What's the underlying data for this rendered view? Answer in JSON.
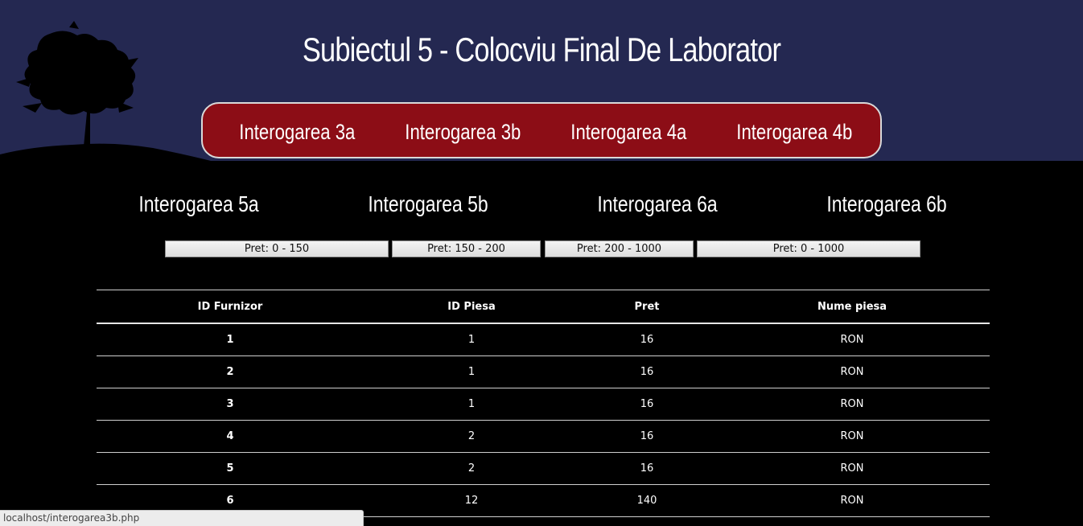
{
  "site": {
    "title": "Subiectul 5 - Colocviu Final De Laborator"
  },
  "nav": {
    "items": [
      {
        "label": "Interogarea 3a"
      },
      {
        "label": "Interogarea 3b"
      },
      {
        "label": "Interogarea 4a"
      },
      {
        "label": "Interogarea 4b"
      }
    ]
  },
  "subnav": {
    "items": [
      {
        "label": "Interogarea 5a"
      },
      {
        "label": "Interogarea 5b"
      },
      {
        "label": "Interogarea 6a"
      },
      {
        "label": "Interogarea 6b"
      }
    ]
  },
  "filters": {
    "buttons": [
      {
        "label": "Pret: 0 - 150"
      },
      {
        "label": "Pret: 150 - 200"
      },
      {
        "label": "Pret: 200 - 1000"
      },
      {
        "label": "Pret: 0 - 1000"
      }
    ]
  },
  "table": {
    "headers": [
      "ID Furnizor",
      "ID Piesa",
      "Pret",
      "Nume piesa"
    ],
    "rows": [
      [
        "1",
        "1",
        "16",
        "RON"
      ],
      [
        "2",
        "1",
        "16",
        "RON"
      ],
      [
        "3",
        "1",
        "16",
        "RON"
      ],
      [
        "4",
        "2",
        "16",
        "RON"
      ],
      [
        "5",
        "2",
        "16",
        "RON"
      ],
      [
        "6",
        "12",
        "140",
        "RON"
      ]
    ]
  },
  "status": {
    "url": "localhost/interogarea3b.php"
  },
  "colors": {
    "header_bg": "#242851",
    "nav_bg": "#8c0d16",
    "page_bg": "#000000"
  }
}
